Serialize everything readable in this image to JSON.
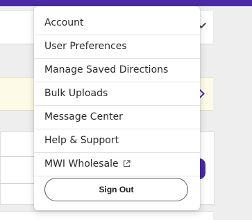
{
  "colors": {
    "brand": "#4a2aa6",
    "notice_bg": "#fdfbe7"
  },
  "menu": {
    "items": [
      {
        "label": "Account"
      },
      {
        "label": "User Preferences"
      },
      {
        "label": "Manage Saved Directions"
      },
      {
        "label": "Bulk Uploads"
      },
      {
        "label": "Message Center"
      },
      {
        "label": "Help & Support"
      },
      {
        "label": "MWI Wholesale",
        "icon": "external-link-icon"
      }
    ],
    "sign_out_label": "Sign Out"
  },
  "background": {
    "dropdown_icon": "chevron-down-icon",
    "notice_icon": "chevron-right-icon"
  }
}
